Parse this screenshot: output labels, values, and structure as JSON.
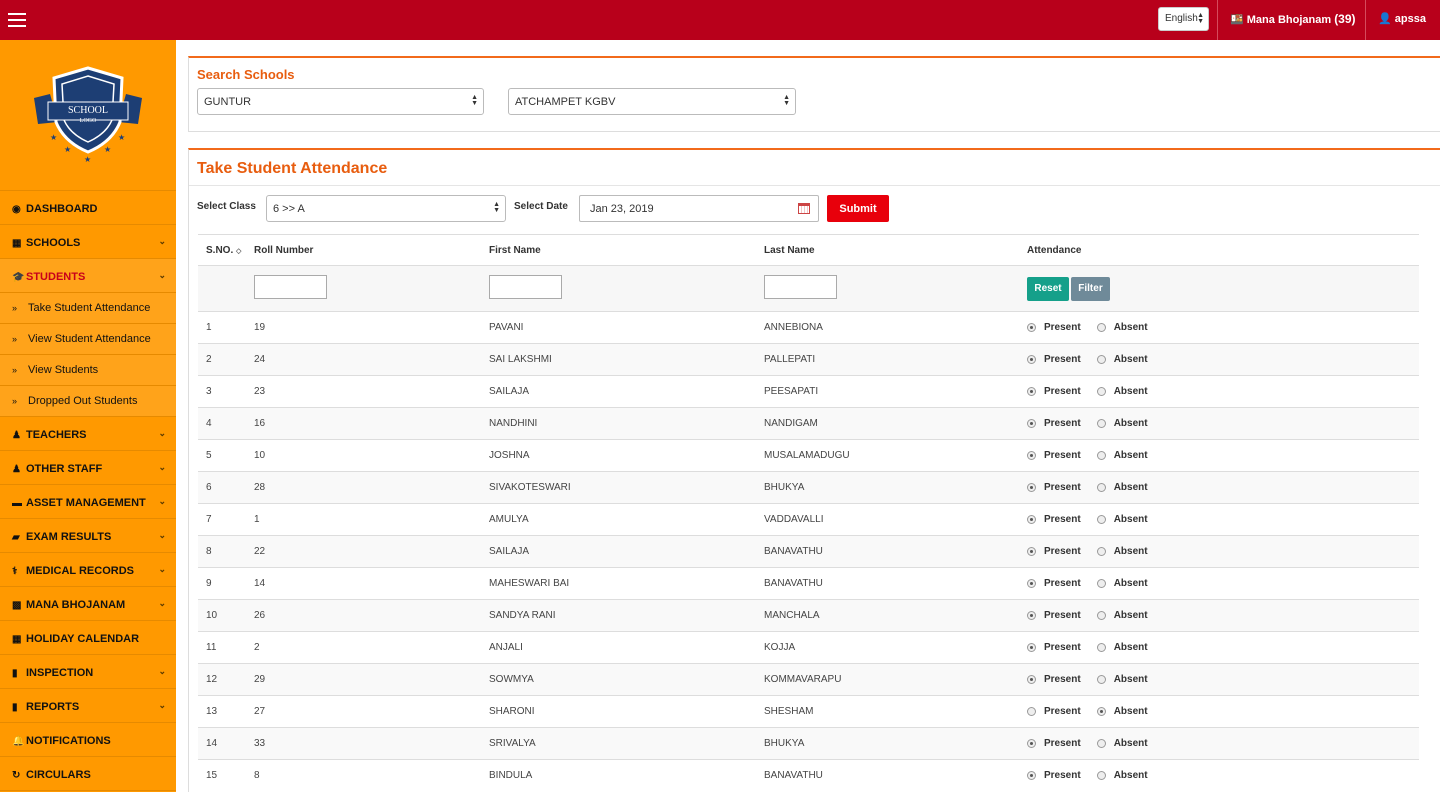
{
  "topbar": {
    "language": "English",
    "mana_bhojanam_label": "Mana Bhojanam",
    "mana_bhojanam_count": "(39)",
    "username": "apssa",
    "menu_icon": "hamburger-icon",
    "bg_color": "#b8001b"
  },
  "logo": {
    "line1": "SCHOOL",
    "line2": "LOGO"
  },
  "sidebar": {
    "items": [
      {
        "label": "DASHBOARD",
        "icon": "dashboard-icon"
      },
      {
        "label": "SCHOOLS",
        "icon": "bank-icon"
      },
      {
        "label": "STUDENTS",
        "icon": "graduation-cap-icon"
      },
      {
        "label": "TEACHERS",
        "icon": "male-icon"
      },
      {
        "label": "OTHER STAFF",
        "icon": "male-icon"
      },
      {
        "label": "ASSET MANAGEMENT",
        "icon": "bed-icon"
      },
      {
        "label": "EXAM RESULTS",
        "icon": "book-icon"
      },
      {
        "label": "MEDICAL RECORDS",
        "icon": "stethoscope-icon"
      },
      {
        "label": "MANA BHOJANAM",
        "icon": "meal-icon"
      },
      {
        "label": "HOLIDAY CALENDAR",
        "icon": "calendar-icon"
      },
      {
        "label": "INSPECTION",
        "icon": "file-icon"
      },
      {
        "label": "REPORTS",
        "icon": "file-icon"
      },
      {
        "label": "NOTIFICATIONS",
        "icon": "bell-icon"
      },
      {
        "label": "CIRCULARS",
        "icon": "refresh-icon"
      }
    ],
    "students_sub": [
      {
        "label": "Take Student Attendance"
      },
      {
        "label": "View Student Attendance"
      },
      {
        "label": "View Students"
      },
      {
        "label": "Dropped Out Students"
      }
    ],
    "bg_color": "#ff9900"
  },
  "search": {
    "title": "Search Schools",
    "district": "GUNTUR",
    "school": "ATCHAMPET KGBV"
  },
  "attendance": {
    "title": "Take Student Attendance",
    "select_class_label": "Select Class",
    "select_class_value": "6 >> A",
    "select_date_label": "Select Date",
    "date_value": "Jan 23, 2019",
    "submit_label": "Submit",
    "reset_label": "Reset",
    "filter_label": "Filter",
    "present_label": "Present",
    "absent_label": "Absent",
    "columns": [
      "S.NO.",
      "Roll Number",
      "First Name",
      "Last Name",
      "Attendance"
    ],
    "rows": [
      {
        "sno": "1",
        "roll": "19",
        "first": "PAVANI",
        "last": "ANNEBIONA",
        "status": "present"
      },
      {
        "sno": "2",
        "roll": "24",
        "first": "SAI LAKSHMI",
        "last": "PALLEPATI",
        "status": "present"
      },
      {
        "sno": "3",
        "roll": "23",
        "first": "SAILAJA",
        "last": "PEESAPATI",
        "status": "present"
      },
      {
        "sno": "4",
        "roll": "16",
        "first": "NANDHINI",
        "last": "NANDIGAM",
        "status": "present"
      },
      {
        "sno": "5",
        "roll": "10",
        "first": "JOSHNA",
        "last": "MUSALAMADUGU",
        "status": "present"
      },
      {
        "sno": "6",
        "roll": "28",
        "first": "SIVAKOTESWARI",
        "last": "BHUKYA",
        "status": "present"
      },
      {
        "sno": "7",
        "roll": "1",
        "first": "AMULYA",
        "last": "VADDAVALLI",
        "status": "present"
      },
      {
        "sno": "8",
        "roll": "22",
        "first": "SAILAJA",
        "last": "BANAVATHU",
        "status": "present"
      },
      {
        "sno": "9",
        "roll": "14",
        "first": "MAHESWARI BAI",
        "last": "BANAVATHU",
        "status": "present"
      },
      {
        "sno": "10",
        "roll": "26",
        "first": "SANDYA RANI",
        "last": "MANCHALA",
        "status": "present"
      },
      {
        "sno": "11",
        "roll": "2",
        "first": "ANJALI",
        "last": "KOJJA",
        "status": "present"
      },
      {
        "sno": "12",
        "roll": "29",
        "first": "SOWMYA",
        "last": "KOMMAVARAPU",
        "status": "present"
      },
      {
        "sno": "13",
        "roll": "27",
        "first": "SHARONI",
        "last": "SHESHAM",
        "status": "absent"
      },
      {
        "sno": "14",
        "roll": "33",
        "first": "SRIVALYA",
        "last": "BHUKYA",
        "status": "present"
      },
      {
        "sno": "15",
        "roll": "8",
        "first": "BINDULA",
        "last": "BANAVATHU",
        "status": "present"
      }
    ]
  }
}
